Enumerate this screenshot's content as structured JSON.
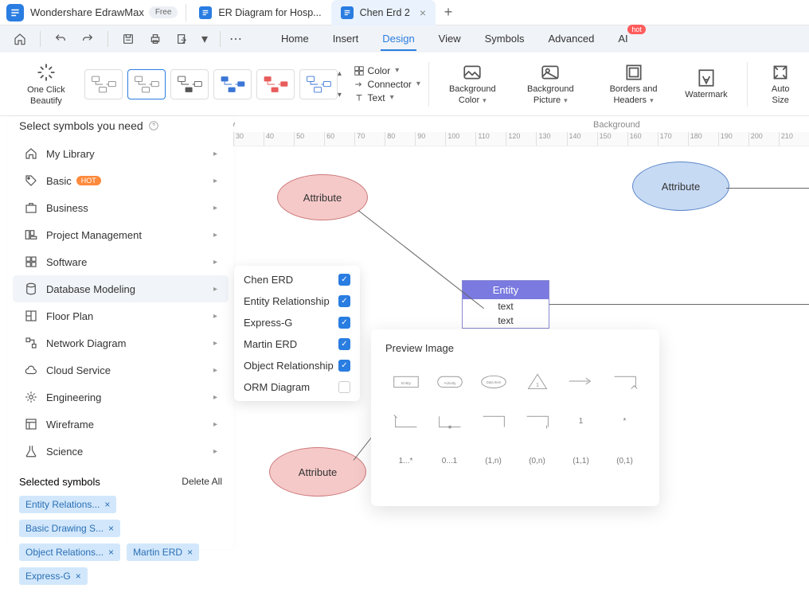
{
  "app": {
    "name": "Wondershare EdrawMax",
    "badge": "Free"
  },
  "tabs": [
    {
      "label": "ER Diagram for Hosp...",
      "active": false
    },
    {
      "label": "Chen Erd 2",
      "active": true
    }
  ],
  "menu": [
    "Home",
    "Insert",
    "Design",
    "View",
    "Symbols",
    "Advanced",
    "AI"
  ],
  "menuActive": "Design",
  "hotBadge": "hot",
  "ribbon": {
    "oneClick": "One Click Beautify",
    "settings": {
      "color": "Color",
      "connector": "Connector",
      "text": "Text"
    },
    "bgColor": "Background Color",
    "bgPic": "Background Picture",
    "borders": "Borders and Headers",
    "watermark": "Watermark",
    "autoSize": "Auto Size",
    "footer1": "utify",
    "footer2": "Background"
  },
  "ruler": [
    "30",
    "40",
    "50",
    "60",
    "70",
    "80",
    "90",
    "100",
    "110",
    "120",
    "130",
    "140",
    "150",
    "160",
    "170",
    "180",
    "190",
    "200",
    "210"
  ],
  "panel": {
    "title": "Select symbols you need",
    "categories": [
      {
        "name": "My Library",
        "icon": "home"
      },
      {
        "name": "Basic",
        "icon": "tag",
        "hot": "HOT"
      },
      {
        "name": "Business",
        "icon": "briefcase"
      },
      {
        "name": "Project Management",
        "icon": "pm"
      },
      {
        "name": "Software",
        "icon": "grid"
      },
      {
        "name": "Database Modeling",
        "icon": "db",
        "active": true
      },
      {
        "name": "Floor Plan",
        "icon": "floor"
      },
      {
        "name": "Network Diagram",
        "icon": "net"
      },
      {
        "name": "Cloud Service",
        "icon": "cloud"
      },
      {
        "name": "Engineering",
        "icon": "eng"
      },
      {
        "name": "Wireframe",
        "icon": "wire"
      },
      {
        "name": "Science",
        "icon": "sci"
      }
    ],
    "selectedTitle": "Selected symbols",
    "deleteAll": "Delete All",
    "chips": [
      "Entity Relations...",
      "Basic Drawing S...",
      "Object Relations...",
      "Martin ERD",
      "Express-G"
    ]
  },
  "submenu": [
    {
      "label": "Chen ERD",
      "checked": true
    },
    {
      "label": "Entity Relationship",
      "checked": true
    },
    {
      "label": "Express-G",
      "checked": true
    },
    {
      "label": "Martin ERD",
      "checked": true
    },
    {
      "label": "Object Relationship",
      "checked": true
    },
    {
      "label": "ORM Diagram",
      "checked": false
    }
  ],
  "preview": {
    "title": "Preview Image",
    "row1": [
      "Entity",
      "Activity",
      "Data Item",
      "",
      "",
      ""
    ],
    "row2": [
      "",
      "",
      "",
      "",
      "1",
      "*"
    ],
    "row3": [
      "1...*",
      "0...1",
      "(1,n)",
      "(0,n)",
      "(1,1)",
      "(0,1)"
    ]
  },
  "erd": {
    "attr": "Attribute",
    "entity": "Entity",
    "text": "text"
  }
}
